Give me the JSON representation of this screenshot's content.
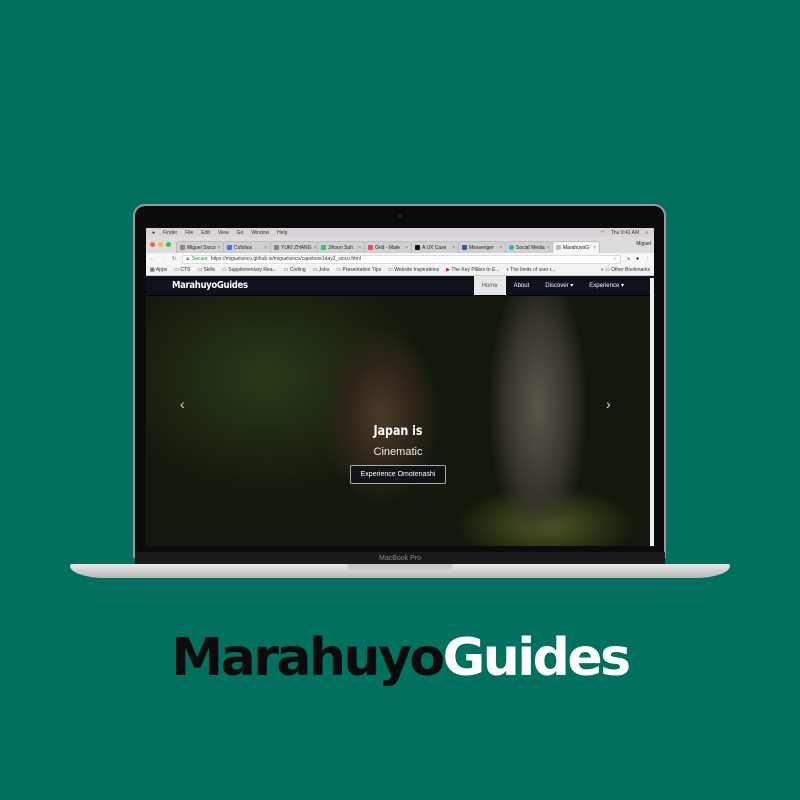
{
  "mac_menu": {
    "items": [
      "Finder",
      "File",
      "Edit",
      "View",
      "Go",
      "Window",
      "Help"
    ],
    "clock": "Thu 9:41 AM"
  },
  "browser": {
    "tabs": [
      {
        "label": "Miguel Sioco"
      },
      {
        "label": "Cofolios"
      },
      {
        "label": "YUKI ZHANG"
      },
      {
        "label": "Jihoon Suh"
      },
      {
        "label": "Grid - Mate"
      },
      {
        "label": "A UX Case"
      },
      {
        "label": "Messenger"
      },
      {
        "label": "Social Media"
      },
      {
        "label": "MarahuyoG",
        "active": true
      }
    ],
    "user": "Miguel",
    "secure_label": "Secure",
    "url": "https://miguelsioco.github.io/miguelsioco/capstone1day2_sioco.html",
    "bookmarks": [
      "Apps",
      "CTS",
      "Skills",
      "Supplementary Rea...",
      "Coding",
      "Jobs",
      "Presentation Tips",
      "Website Inspirations",
      "The Key Pillars to E...",
      "The limits of user r..."
    ],
    "other_bookmarks": "Other Bookmarks"
  },
  "site": {
    "brand": "MarahuyoGuides",
    "nav": [
      {
        "label": "Home",
        "active": true
      },
      {
        "label": "About"
      },
      {
        "label": "Discover ▾"
      },
      {
        "label": "Experience ▾"
      }
    ],
    "hero": {
      "line1": "Japan is",
      "line2": "Cinematic",
      "cta": "Experience Omotenashi"
    }
  },
  "device_label": "MacBook Pro",
  "logo": {
    "part1": "Marahuyo",
    "part2": "Guides",
    "colors": {
      "part1": "#0b0b0b",
      "part2": "#ffffff"
    }
  },
  "colors": {
    "background": "#02705f",
    "navbar": "#0d111c"
  }
}
